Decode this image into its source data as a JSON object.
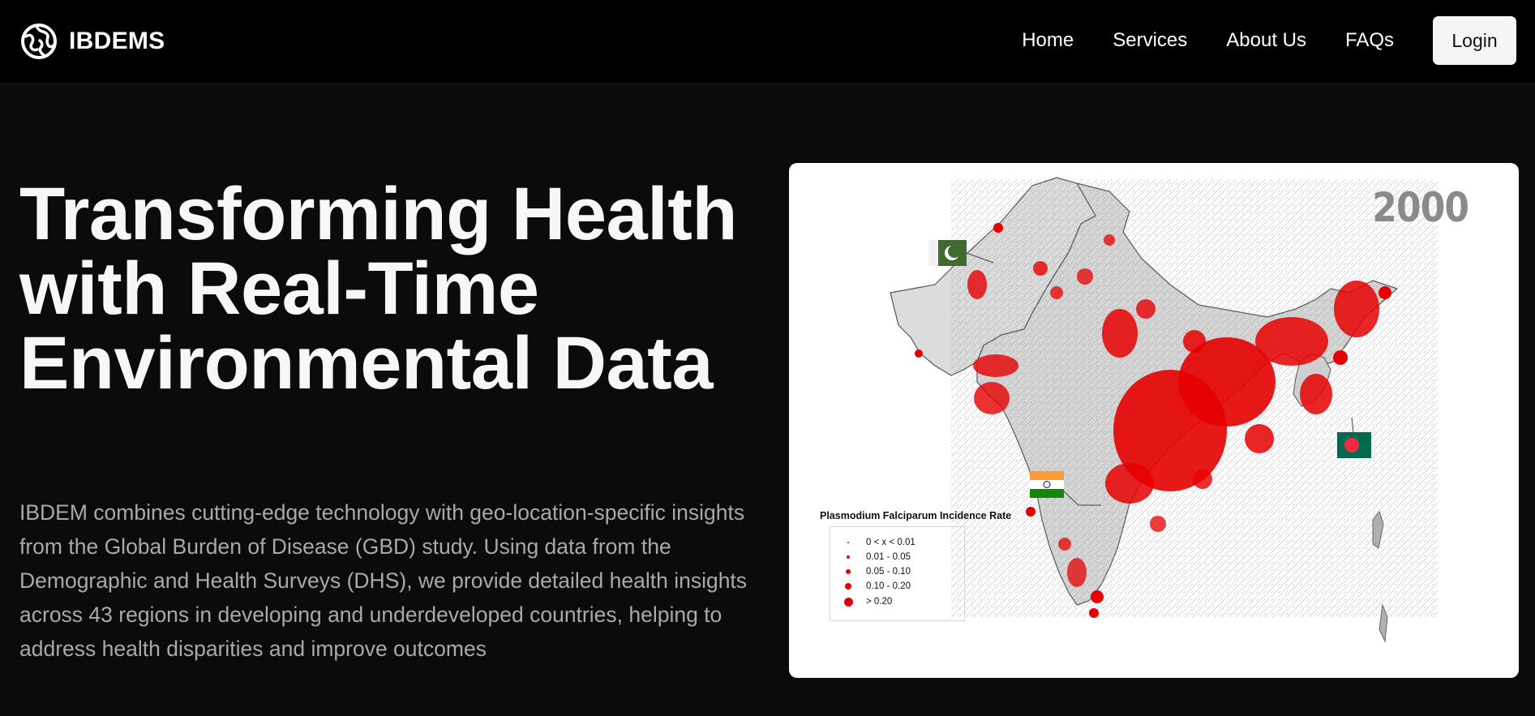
{
  "brand": {
    "name": "IBDEMS",
    "icon": "globe-logo-icon"
  },
  "nav": {
    "links": [
      "Home",
      "Services",
      "About Us",
      "FAQs"
    ],
    "login_label": "Login"
  },
  "hero": {
    "title": "Transforming Health with Real-Time Environmental Data",
    "description": "IBDEM combines cutting-edge technology with geo-location-specific insights from the Global Burden of Disease (GBD) study. Using data from the Demographic and Health Surveys (DHS), we provide detailed health insights across 43 regions in developing and underdeveloped countries, helping to address health disparities and improve outcomes"
  },
  "map": {
    "year": "2000",
    "legend_title": "Plasmodium Falciparum Incidence Rate",
    "legend_items": [
      "0 < x <  0.01",
      "0.01  - 0.05",
      "0.05  - 0.10",
      "0.10  - 0.20",
      "> 0.20"
    ],
    "flags": [
      "pakistan-flag-icon",
      "india-flag-icon",
      "bangladesh-flag-icon"
    ],
    "marker_color": "#e60000",
    "land_color": "#d9d9d9"
  },
  "colors": {
    "page_bg": "#0b0b0b",
    "nav_bg": "#000000",
    "text_primary": "#f7f7f7",
    "text_secondary": "#a9a9a9"
  }
}
